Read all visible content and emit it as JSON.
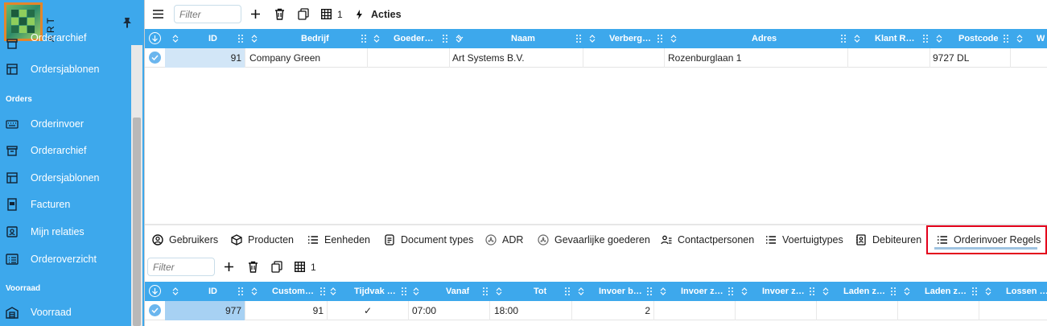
{
  "sidebar": {
    "brand": "ART",
    "items": [
      {
        "label": "Orderarchief",
        "icon": "archive-icon"
      },
      {
        "label": "Ordersjablonen",
        "icon": "template-icon"
      },
      {
        "label": "Orderinvoer",
        "icon": "keyboard-icon"
      },
      {
        "label": "Orderarchief",
        "icon": "archive-icon"
      },
      {
        "label": "Ordersjablonen",
        "icon": "template-icon"
      },
      {
        "label": "Facturen",
        "icon": "invoice-icon"
      },
      {
        "label": "Mijn relaties",
        "icon": "contacts-icon"
      },
      {
        "label": "Orderoverzicht",
        "icon": "list-icon"
      },
      {
        "label": "Voorraad",
        "icon": "warehouse-icon"
      }
    ],
    "sections": {
      "orders": "Orders",
      "voorraad": "Voorraad"
    }
  },
  "top_toolbar": {
    "filter_placeholder": "Filter",
    "layout_count": "1",
    "acties": "Acties"
  },
  "top_grid": {
    "columns": [
      "ID",
      "Bedrijf",
      "Goeder…",
      "Naam",
      "Verberg…",
      "Adres",
      "Klant R…",
      "Postcode",
      "W"
    ],
    "rows": [
      {
        "id": "91",
        "bedrijf": "Company Green",
        "goederen": "",
        "naam": "Art Systems B.V.",
        "verbergen": "",
        "adres": "Rozenburglaan 1",
        "klant": "",
        "postcode": "9727 DL"
      }
    ]
  },
  "tabs": [
    {
      "label": "Gebruikers",
      "icon": "user-circle-icon"
    },
    {
      "label": "Producten",
      "icon": "box-icon"
    },
    {
      "label": "Eenheden",
      "icon": "list-icon"
    },
    {
      "label": "Document types",
      "icon": "document-icon"
    },
    {
      "label": "ADR",
      "icon": "hazard-icon"
    },
    {
      "label": "Gevaarlijke goederen",
      "icon": "hazard-icon"
    },
    {
      "label": "Contactpersonen",
      "icon": "contact-icon"
    },
    {
      "label": "Voertuigtypes",
      "icon": "list-icon"
    },
    {
      "label": "Debiteuren",
      "icon": "contacts-icon"
    },
    {
      "label": "Orderinvoer Regels",
      "icon": "list-icon",
      "active": true
    }
  ],
  "bottom_toolbar": {
    "filter_placeholder": "Filter",
    "layout_count": "1"
  },
  "bottom_grid": {
    "columns": [
      "ID",
      "Custom…",
      "Tijdvak …",
      "Vanaf",
      "Tot",
      "Invoer b…",
      "Invoer z…",
      "Invoer z…",
      "Laden z…",
      "Laden z…",
      "Lossen …"
    ],
    "rows": [
      {
        "id": "977",
        "customer": "91",
        "tijdvak": "✓",
        "vanaf": "07:00",
        "tot": "18:00",
        "invoer_b": "2"
      }
    ]
  },
  "colors": {
    "accent": "#3da8ec",
    "highlight": "#e3001b",
    "logo_border": "#e3862c"
  }
}
